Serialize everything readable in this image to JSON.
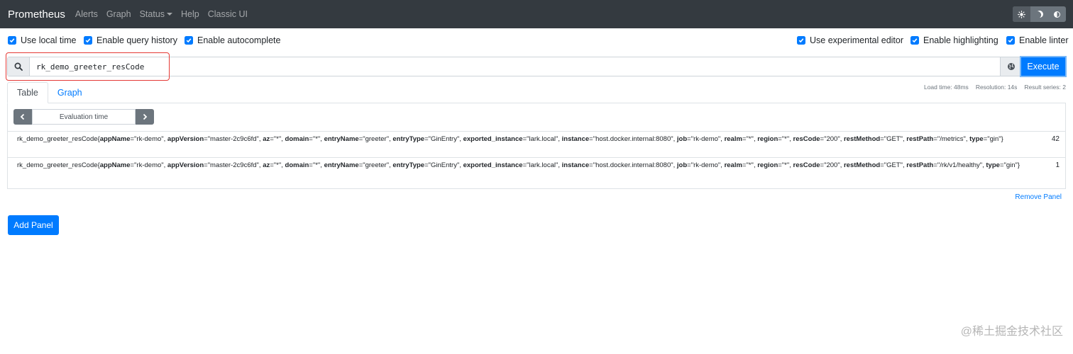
{
  "navbar": {
    "brand": "Prometheus",
    "links": [
      "Alerts",
      "Graph",
      "Status",
      "Help",
      "Classic UI"
    ],
    "theme_icons": [
      "sun-icon",
      "moon-icon",
      "contrast-icon"
    ]
  },
  "options": {
    "left": [
      "Use local time",
      "Enable query history",
      "Enable autocomplete"
    ],
    "right": [
      "Use experimental editor",
      "Enable highlighting",
      "Enable linter"
    ]
  },
  "query": {
    "value": "rk_demo_greeter_resCode",
    "execute_label": "Execute"
  },
  "tabs": {
    "table": "Table",
    "graph": "Graph"
  },
  "stats": {
    "load_time": "Load time: 48ms",
    "resolution": "Resolution: 14s",
    "result_series": "Result series: 2"
  },
  "panel": {
    "eval_placeholder": "Evaluation time",
    "results": [
      {
        "metric": "rk_demo_greeter_resCode",
        "labels": [
          [
            "appName",
            "rk-demo"
          ],
          [
            "appVersion",
            "master-2c9c6fd"
          ],
          [
            "az",
            "*"
          ],
          [
            "domain",
            "*"
          ],
          [
            "entryName",
            "greeter"
          ],
          [
            "entryType",
            "GinEntry"
          ],
          [
            "exported_instance",
            "lark.local"
          ],
          [
            "instance",
            "host.docker.internal:8080"
          ],
          [
            "job",
            "rk-demo"
          ],
          [
            "realm",
            "*"
          ],
          [
            "region",
            "*"
          ],
          [
            "resCode",
            "200"
          ],
          [
            "restMethod",
            "GET"
          ],
          [
            "restPath",
            "/metrics"
          ],
          [
            "type",
            "gin"
          ]
        ],
        "value": "42"
      },
      {
        "metric": "rk_demo_greeter_resCode",
        "labels": [
          [
            "appName",
            "rk-demo"
          ],
          [
            "appVersion",
            "master-2c9c6fd"
          ],
          [
            "az",
            "*"
          ],
          [
            "domain",
            "*"
          ],
          [
            "entryName",
            "greeter"
          ],
          [
            "entryType",
            "GinEntry"
          ],
          [
            "exported_instance",
            "lark.local"
          ],
          [
            "instance",
            "host.docker.internal:8080"
          ],
          [
            "job",
            "rk-demo"
          ],
          [
            "realm",
            "*"
          ],
          [
            "region",
            "*"
          ],
          [
            "resCode",
            "200"
          ],
          [
            "restMethod",
            "GET"
          ],
          [
            "restPath",
            "/rk/v1/healthy"
          ],
          [
            "type",
            "gin"
          ]
        ],
        "value": "1"
      }
    ],
    "remove_label": "Remove Panel"
  },
  "add_panel_label": "Add Panel",
  "watermark": "@稀土掘金技术社区",
  "colors": {
    "navbar": "#343a40",
    "primary": "#007bff",
    "highlight": "#e53935"
  }
}
